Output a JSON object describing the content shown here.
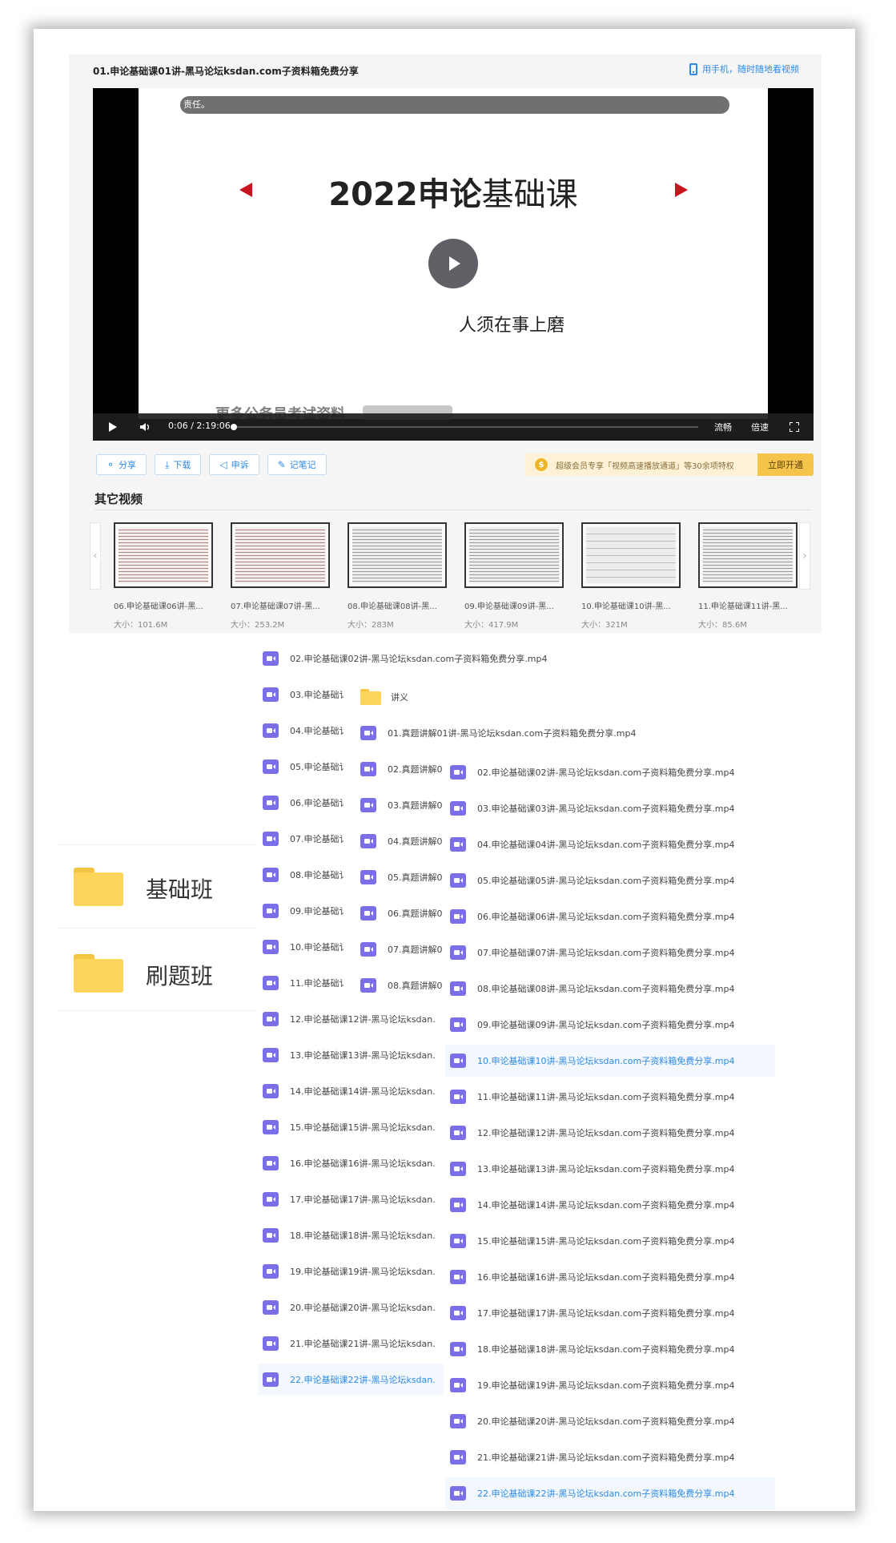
{
  "player": {
    "title": "01.申论基础课01讲-黑马论坛ksdan.com子资料箱免费分享",
    "mobile_link": "用手机，随时随地看视频",
    "slide": {
      "top_bar_text": "责任。",
      "heading_bold": "2022申论",
      "heading_light": "基础课",
      "subtitle": "人须在事上磨",
      "watermark": "更多公务员考试资料"
    },
    "controls": {
      "time": "0:06 / 2:19:06",
      "progress": 0.0007,
      "quality": "流畅",
      "speed": "倍速"
    },
    "actions": {
      "share": "分享",
      "download": "下载",
      "report": "申诉",
      "note": "记笔记"
    },
    "vip": {
      "icon": "$",
      "text": "超级会员专享「视频高速播放通道」等30余项特权",
      "button": "立即开通"
    },
    "other_title": "其它视频",
    "arrows": {
      "prev": "‹",
      "next": "›"
    },
    "other_videos": [
      {
        "name": "06.申论基础课06讲-黑...",
        "size": "大小：101.6M"
      },
      {
        "name": "07.申论基础课07讲-黑...",
        "size": "大小：253.2M"
      },
      {
        "name": "08.申论基础课08讲-黑...",
        "size": "大小：283M"
      },
      {
        "name": "09.申论基础课09讲-黑...",
        "size": "大小：417.9M"
      },
      {
        "name": "10.申论基础课10讲-黑...",
        "size": "大小：321M"
      },
      {
        "name": "11.申论基础课11讲-黑...",
        "size": "大小：85.6M"
      }
    ]
  },
  "folders": [
    {
      "name": "基础班"
    },
    {
      "name": "刷题班"
    }
  ],
  "list_a": [
    "02.申论基础课02讲-黑马论坛ksdan.com子资料箱免费分享.mp4",
    "03.申论基础讠",
    "04.申论基础讠",
    "05.申论基础讠",
    "06.申论基础讠",
    "07.申论基础讠",
    "08.申论基础讠",
    "09.申论基础讠",
    "10.申论基础讠",
    "11.申论基础讠",
    "12.申论基础课12讲-黑马论坛ksdan.",
    "13.申论基础课13讲-黑马论坛ksdan.",
    "14.申论基础课14讲-黑马论坛ksdan.",
    "15.申论基础课15讲-黑马论坛ksdan.",
    "16.申论基础课16讲-黑马论坛ksdan.",
    "17.申论基础课17讲-黑马论坛ksdan.",
    "18.申论基础课18讲-黑马论坛ksdan.",
    "19.申论基础课19讲-黑马论坛ksdan.",
    "20.申论基础课20讲-黑马论坛ksdan.",
    "21.申论基础课21讲-黑马论坛ksdan.",
    "22.申论基础课22讲-黑马论坛ksdan."
  ],
  "list_b": {
    "folder": "讲义",
    "items": [
      "01.真题讲解01讲-黑马论坛ksdan.com子资料箱免费分享.mp4",
      "02.真题讲解0",
      "03.真题讲解0",
      "04.真题讲解0",
      "05.真题讲解0",
      "06.真题讲解0",
      "07.真题讲解0",
      "08.真题讲解0"
    ]
  },
  "list_c": [
    "02.申论基础课02讲-黑马论坛ksdan.com子资料箱免费分享.mp4",
    "03.申论基础课03讲-黑马论坛ksdan.com子资料箱免费分享.mp4",
    "04.申论基础课04讲-黑马论坛ksdan.com子资料箱免费分享.mp4",
    "05.申论基础课05讲-黑马论坛ksdan.com子资料箱免费分享.mp4",
    "06.申论基础课06讲-黑马论坛ksdan.com子资料箱免费分享.mp4",
    "07.申论基础课07讲-黑马论坛ksdan.com子资料箱免费分享.mp4",
    "08.申论基础课08讲-黑马论坛ksdan.com子资料箱免费分享.mp4",
    "09.申论基础课09讲-黑马论坛ksdan.com子资料箱免费分享.mp4",
    "10.申论基础课10讲-黑马论坛ksdan.com子资料箱免费分享.mp4",
    "11.申论基础课11讲-黑马论坛ksdan.com子资料箱免费分享.mp4",
    "12.申论基础课12讲-黑马论坛ksdan.com子资料箱免费分享.mp4",
    "13.申论基础课13讲-黑马论坛ksdan.com子资料箱免费分享.mp4",
    "14.申论基础课14讲-黑马论坛ksdan.com子资料箱免费分享.mp4",
    "15.申论基础课15讲-黑马论坛ksdan.com子资料箱免费分享.mp4",
    "16.申论基础课16讲-黑马论坛ksdan.com子资料箱免费分享.mp4",
    "17.申论基础课17讲-黑马论坛ksdan.com子资料箱免费分享.mp4",
    "18.申论基础课18讲-黑马论坛ksdan.com子资料箱免费分享.mp4",
    "19.申论基础课19讲-黑马论坛ksdan.com子资料箱免费分享.mp4",
    "20.申论基础课20讲-黑马论坛ksdan.com子资料箱免费分享.mp4",
    "21.申论基础课21讲-黑马论坛ksdan.com子资料箱免费分享.mp4",
    "22.申论基础课22讲-黑马论坛ksdan.com子资料箱免费分享.mp4"
  ],
  "colors": {
    "accent": "#2e8ae6",
    "video_icon": "#7a6fe6",
    "folder": "#fcd55a",
    "arrow_red": "#c8141e"
  },
  "icons": {
    "video_file": "video-file-icon",
    "folder": "folder-icon",
    "phone": "phone-icon"
  }
}
